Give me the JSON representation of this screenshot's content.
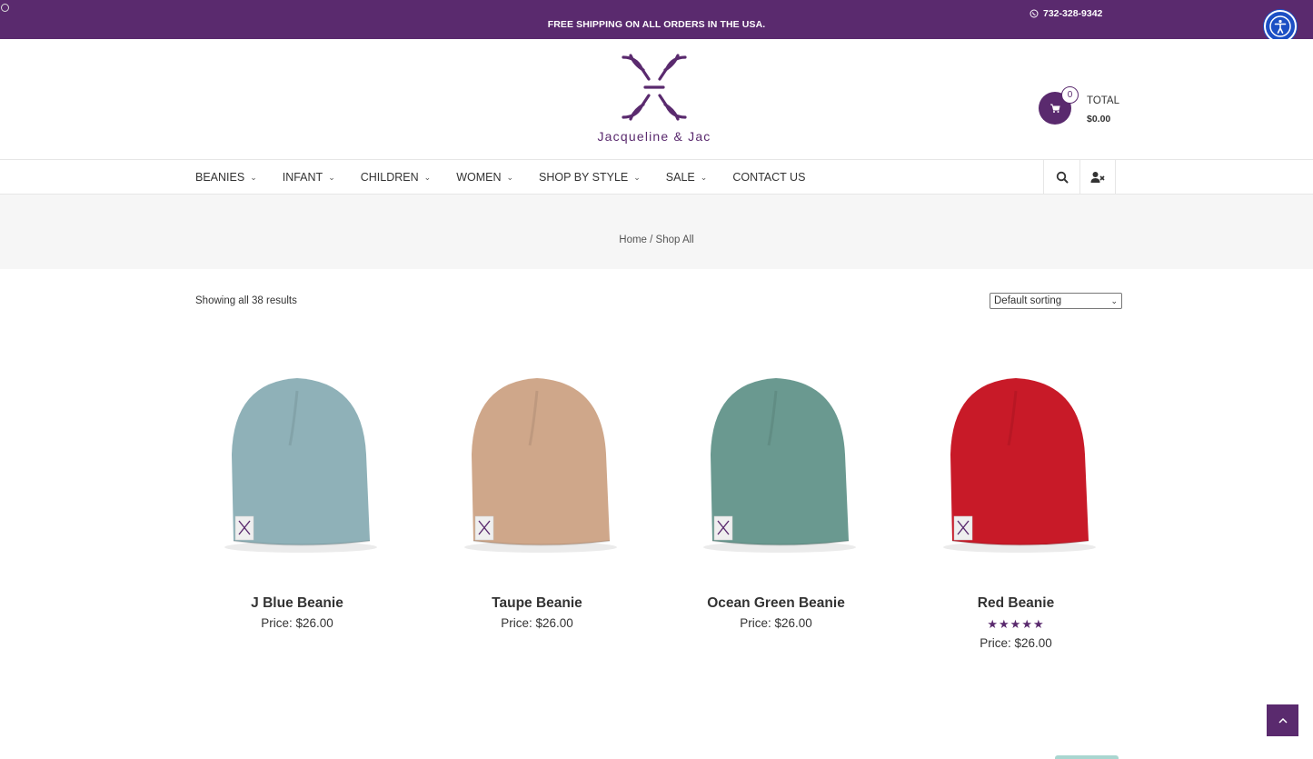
{
  "topbar": {
    "shipping": "FREE SHIPPING ON ALL ORDERS IN THE USA.",
    "phone": "732-328-9342"
  },
  "header": {
    "brand": "Jacqueline & Jac",
    "cart_count": "0",
    "total_label": "TOTAL",
    "total_value": "$0.00"
  },
  "nav": {
    "items": [
      "BEANIES",
      "INFANT",
      "CHILDREN",
      "WOMEN",
      "SHOP BY STYLE",
      "SALE",
      "CONTACT US"
    ]
  },
  "breadcrumb": "Home / Shop All",
  "shop": {
    "result_count": "Showing all 38 results",
    "sort_selected": "Default sorting"
  },
  "products": [
    {
      "name": "J Blue Beanie",
      "price": "Price:  $26.00",
      "color": "#8fb1b8",
      "rating": null
    },
    {
      "name": "Taupe Beanie",
      "price": "Price:  $26.00",
      "color": "#cfa78a",
      "rating": null
    },
    {
      "name": "Ocean Green Beanie",
      "price": "Price:  $26.00",
      "color": "#6a9990",
      "rating": null
    },
    {
      "name": "Red Beanie",
      "price": "Price:  $26.00",
      "color": "#c81a28",
      "rating": 5
    }
  ],
  "colors": {
    "brand_purple": "#5a2a6e",
    "accessibility_blue": "#1b4fc4"
  }
}
